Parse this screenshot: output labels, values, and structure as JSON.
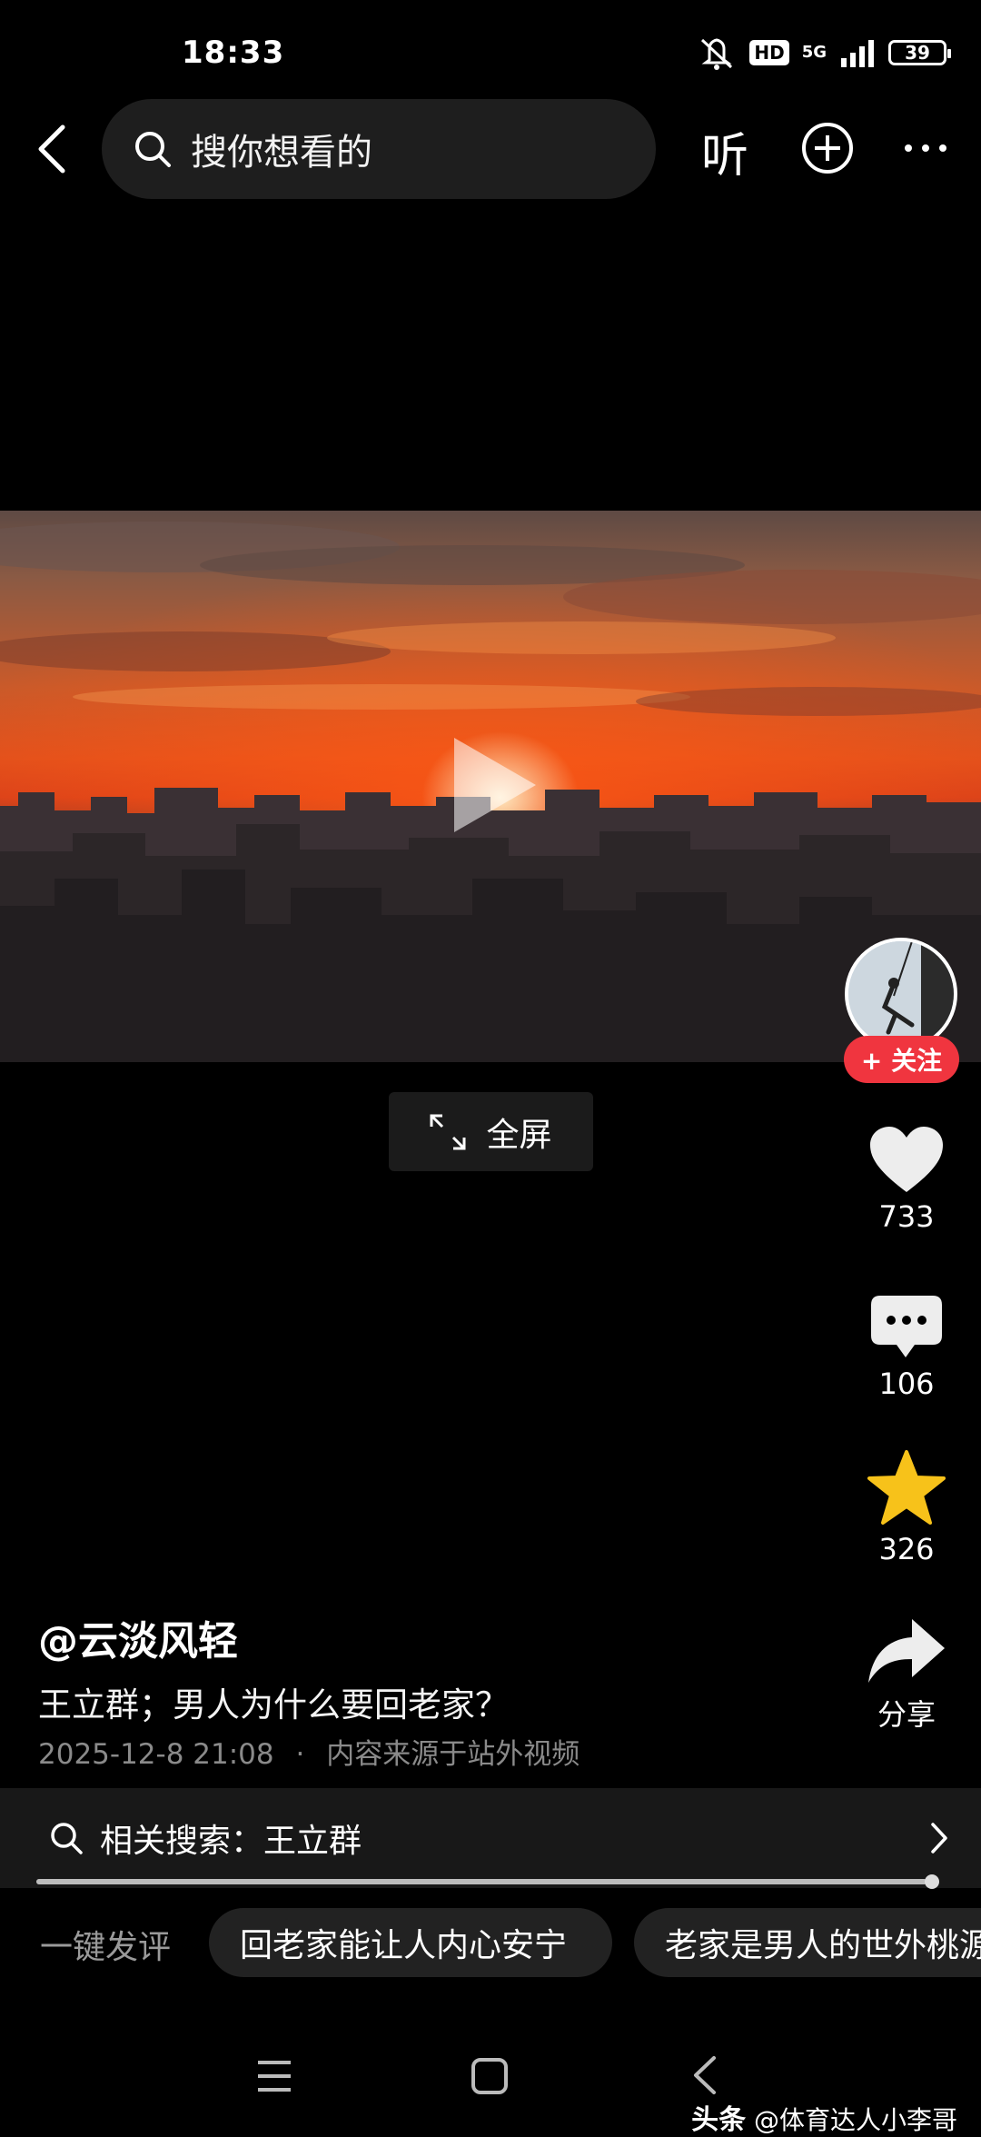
{
  "status": {
    "time": "18:33",
    "hd": "HD",
    "network": "5G",
    "battery": "39"
  },
  "search": {
    "placeholder": "搜你想看的"
  },
  "header": {
    "listen_label": "听"
  },
  "video": {
    "fullscreen_label": "全屏"
  },
  "actions": {
    "follow_label": "+ 关注",
    "likes": "733",
    "comments": "106",
    "favorites": "326",
    "share_label": "分享"
  },
  "post": {
    "author": "@云淡风轻",
    "title": "王立群；男人为什么要回老家？",
    "date": "2025-12-8 21:08",
    "separator": "·",
    "source": "内容来源于站外视频"
  },
  "related": {
    "text": "相关搜索：王立群"
  },
  "progress": {
    "fraction": 0.99
  },
  "quick_comments": {
    "label": "一键发评",
    "chips": [
      "回老家能让人内心安宁",
      "老家是男人的世外桃源"
    ]
  },
  "watermark": {
    "brand": "头条",
    "handle": "@体育达人小李哥"
  },
  "colors": {
    "background": "#000000",
    "follow": "#f0353f",
    "favorite": "#f7c21a"
  },
  "icons": [
    "back-icon",
    "search-icon",
    "add-circle-icon",
    "more-icon",
    "expand-icon",
    "heart-icon",
    "comment-icon",
    "star-icon",
    "share-icon",
    "chevron-right-icon",
    "menu-icon",
    "home-icon",
    "nav-back-icon"
  ]
}
